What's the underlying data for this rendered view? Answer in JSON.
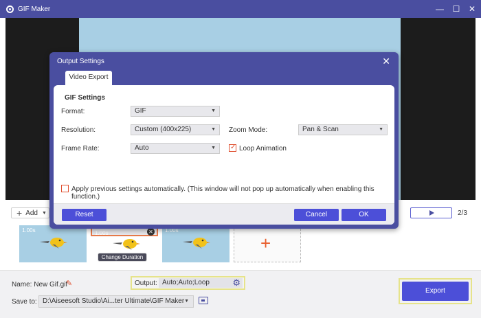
{
  "window": {
    "title": "GIF Maker",
    "controls": [
      "—",
      "☐",
      "✕"
    ]
  },
  "toolbar": {
    "add_label": "Add",
    "page_count": "2/3"
  },
  "thumbnails": [
    {
      "duration": "1.00s",
      "selected": false
    },
    {
      "duration": "1.00s",
      "selected": true,
      "change_label": "Change Duration"
    },
    {
      "duration": "1.00s",
      "selected": false
    }
  ],
  "bottom": {
    "name_label": "Name:",
    "name_value": "New Gif.gif",
    "output_label": "Output:",
    "output_value": "Auto;Auto;Loop",
    "save_label": "Save to:",
    "save_path": "D:\\Aiseesoft Studio\\Ai...ter Ultimate\\GIF Maker",
    "export_label": "Export"
  },
  "dialog": {
    "title": "Output Settings",
    "tab_label": "Video Export",
    "section_title": "GIF Settings",
    "format_label": "Format:",
    "format_value": "GIF",
    "resolution_label": "Resolution:",
    "resolution_value": "Custom (400x225)",
    "zoom_label": "Zoom Mode:",
    "zoom_value": "Pan & Scan",
    "framerate_label": "Frame Rate:",
    "framerate_value": "Auto",
    "loop_label": "Loop Animation",
    "loop_checked": true,
    "apply_label": "Apply previous settings automatically. (This window will not pop up automatically when enabling this function.)",
    "apply_checked": false,
    "reset_label": "Reset",
    "cancel_label": "Cancel",
    "ok_label": "OK"
  },
  "colors": {
    "accent": "#4c4fd8",
    "titlebar": "#4a4ea0",
    "highlight": "#e6e38a",
    "warning": "#e05030"
  }
}
